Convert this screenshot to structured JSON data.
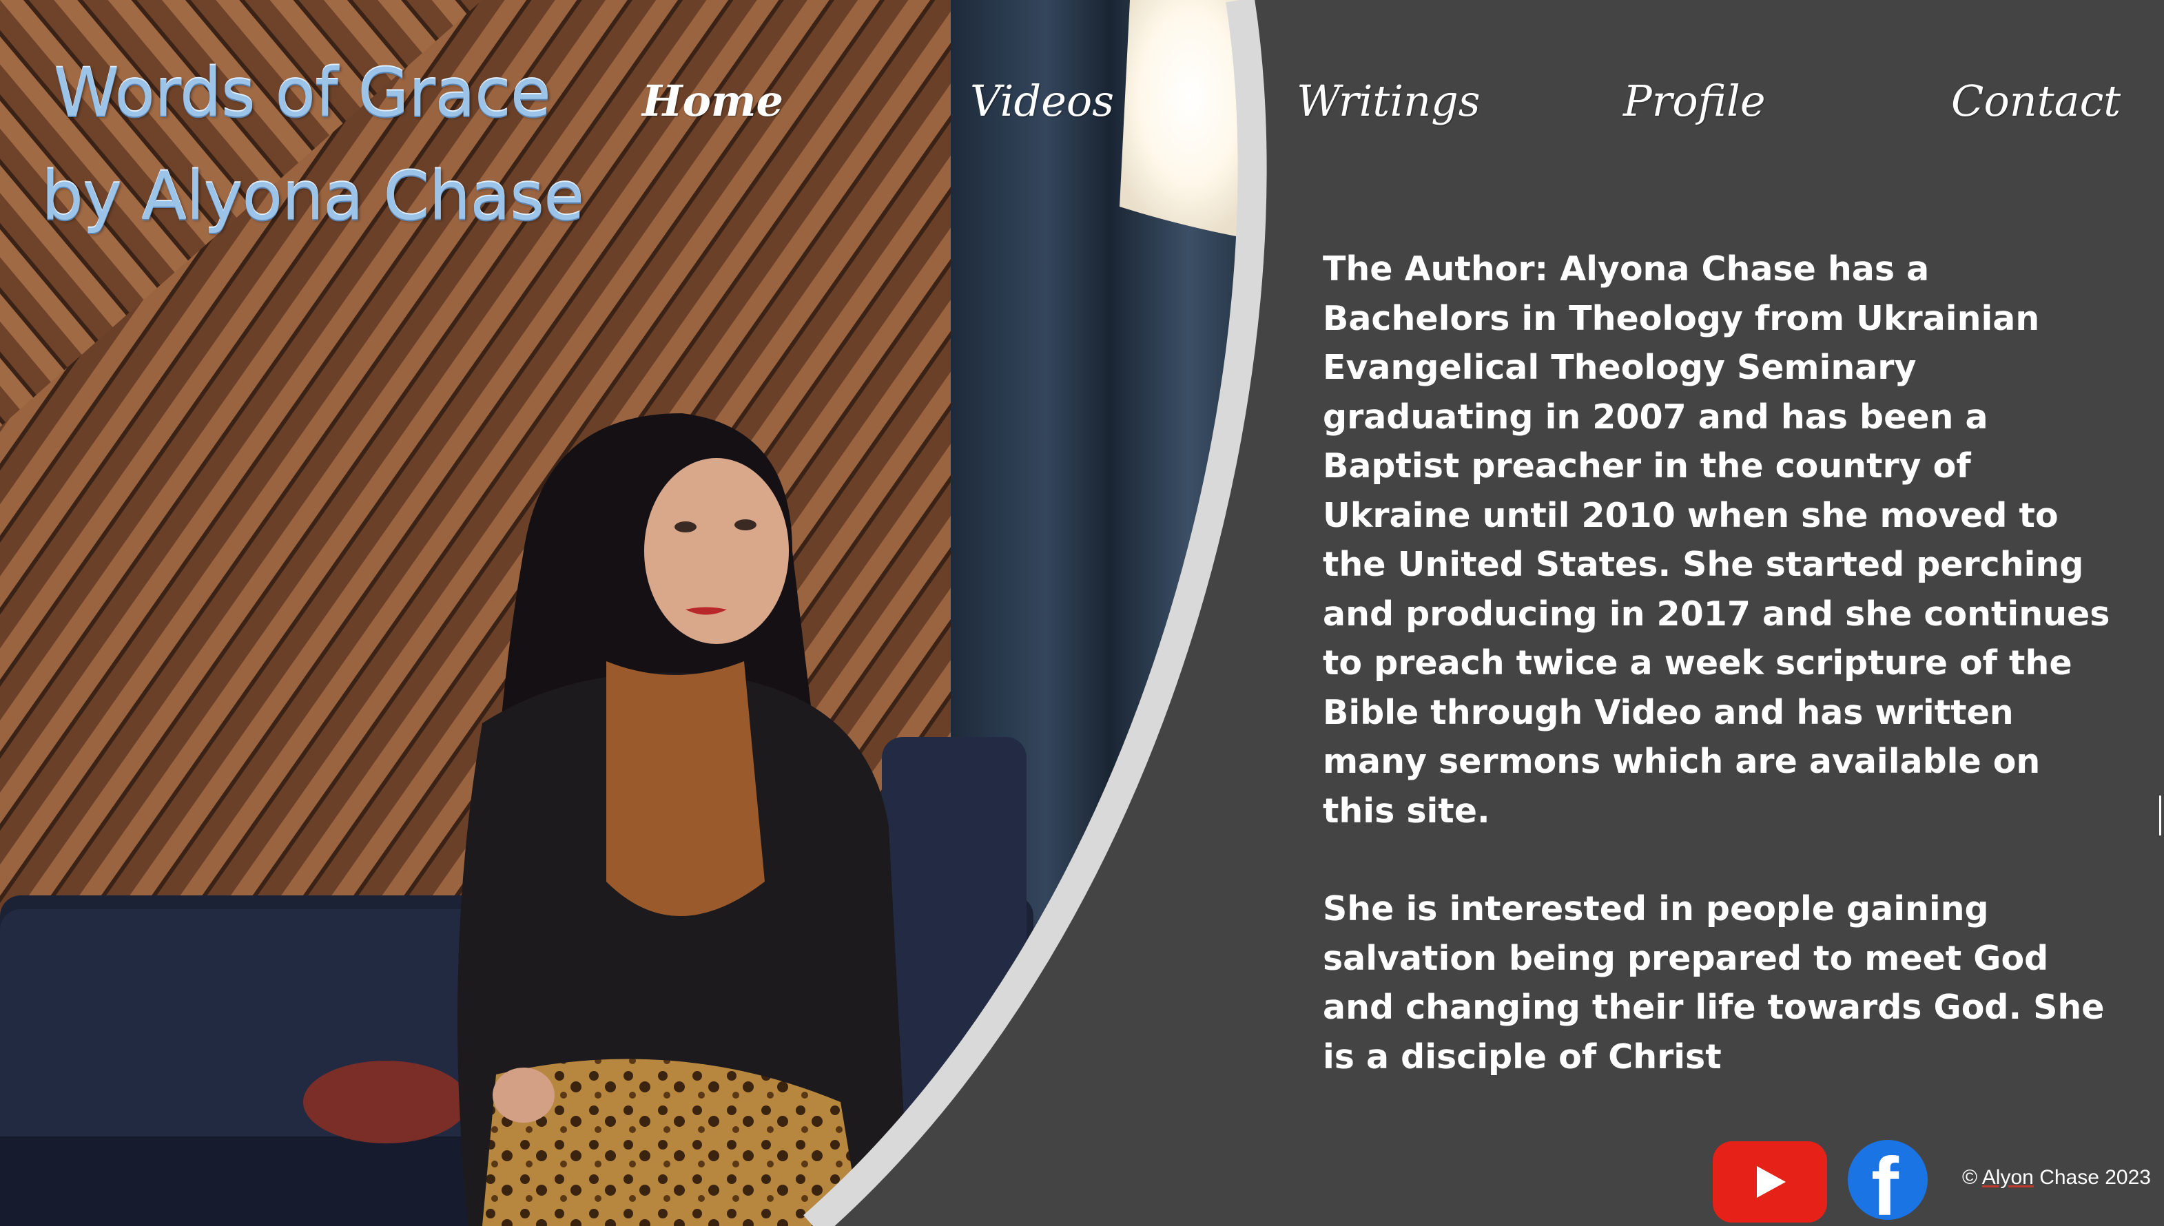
{
  "site": {
    "title_line1": "Words of Grace",
    "title_line2": "by Alyona Chase"
  },
  "nav": {
    "items": [
      {
        "label": "Home",
        "active": true
      },
      {
        "label": "Videos",
        "active": false
      },
      {
        "label": "Writings",
        "active": false
      },
      {
        "label": "Profile",
        "active": false
      },
      {
        "label": "Contact",
        "active": false
      }
    ]
  },
  "about": {
    "paragraph1": "The Author: Alyona Chase has a Bachelors in Theology from Ukrainian Evangelical Theology Seminary graduating in 2007 and has been a Baptist preacher in the country of Ukraine until 2010 when she moved to the United States. She started perching and producing in 2017 and she continues to preach twice a week scripture of the Bible through Video and has written many sermons which are available on this site.",
    "paragraph2": "She is interested in people gaining salvation being prepared to meet God and changing their life towards God. She is a disciple of Christ"
  },
  "footer": {
    "copyright_prefix": "©",
    "copyright_name": "Alyon",
    "copyright_rest": "Chase 2023",
    "youtube_icon": "youtube-icon",
    "facebook_icon": "facebook-icon"
  },
  "colors": {
    "background": "#444444",
    "title": "#9cc4e8",
    "text": "#ffffff",
    "youtube": "#e62117",
    "facebook": "#1b74e4",
    "divider": "#d9d9d9"
  }
}
